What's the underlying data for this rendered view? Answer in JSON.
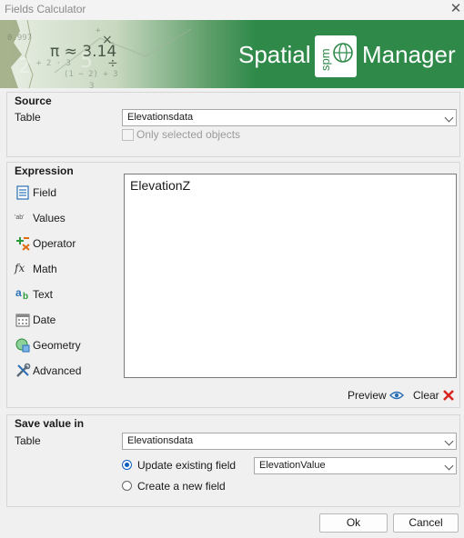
{
  "window": {
    "title": "Fields Calculator",
    "close_symbol": "✕"
  },
  "banner": {
    "brand_left": "Spatial",
    "brand_logo": "spm",
    "brand_right": "Manager",
    "math_text": "π ≈ 3.14",
    "colors": {
      "green": "#2f8a4a",
      "text": "#ffffff"
    }
  },
  "source": {
    "title": "Source",
    "table_label": "Table",
    "table_value": "Elevationsdata",
    "only_selected_label": "Only selected objects",
    "only_selected_checked": false
  },
  "expression": {
    "title": "Expression",
    "tools": [
      {
        "label": "Field",
        "icon": "field-icon"
      },
      {
        "label": "Values",
        "icon": "values-icon"
      },
      {
        "label": "Operator",
        "icon": "operator-icon"
      },
      {
        "label": "Math",
        "icon": "math-icon"
      },
      {
        "label": "Text",
        "icon": "text-icon"
      },
      {
        "label": "Date",
        "icon": "date-icon"
      },
      {
        "label": "Geometry",
        "icon": "geometry-icon"
      },
      {
        "label": "Advanced",
        "icon": "advanced-icon"
      }
    ],
    "values_icon_text": "'ab'",
    "text_icon_a": "a",
    "text_icon_b": "b",
    "math_icon_text": "fx",
    "content": "ElevationZ",
    "preview_label": "Preview",
    "clear_label": "Clear"
  },
  "save": {
    "title": "Save value in",
    "table_label": "Table",
    "table_value": "Elevationsdata",
    "update_label": "Update existing field",
    "update_selected": true,
    "field_value": "ElevationValue",
    "new_label": "Create a new field"
  },
  "buttons": {
    "ok": "Ok",
    "cancel": "Cancel"
  }
}
